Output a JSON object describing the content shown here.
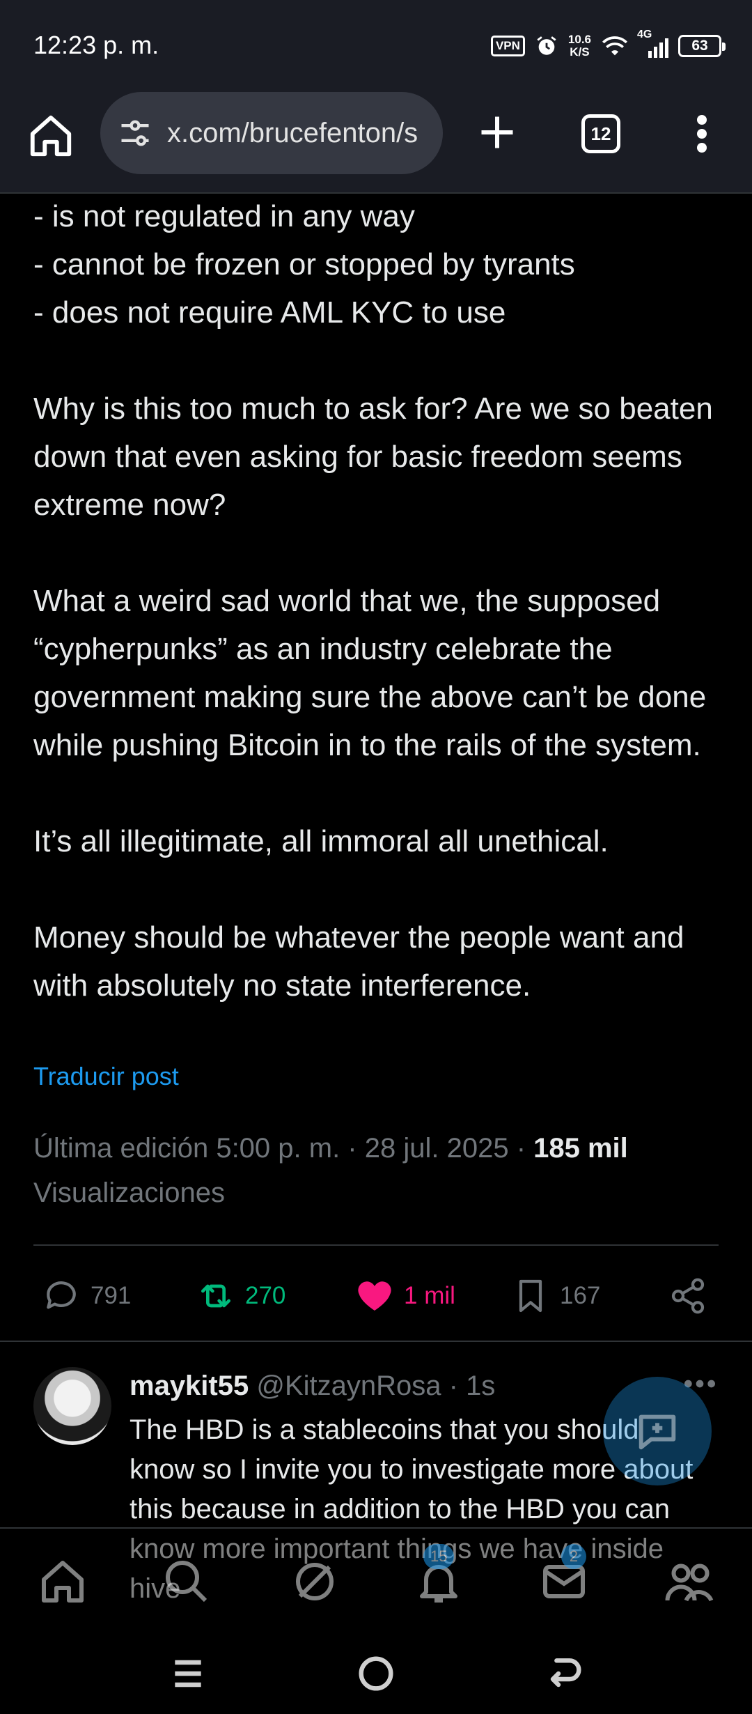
{
  "status": {
    "time": "12:23 p. m.",
    "vpn": "VPN",
    "speed_value": "10.6",
    "speed_unit": "K/S",
    "network": "4G",
    "battery": "63"
  },
  "browser": {
    "url": "x.com/brucefenton/s",
    "tab_count": "12"
  },
  "post": {
    "paragraphs": [
      "- is not regulated in any way\n- cannot be frozen or stopped by tyrants\n- does not require AML KYC to use",
      "Why is this too much to ask for?  Are we so beaten down that even asking for basic freedom seems extreme now?",
      "What a weird sad world that we, the supposed “cypherpunks” as an industry celebrate the government making sure the above can’t be done while pushing Bitcoin in to the rails of the system.",
      "It’s all illegitimate, all immoral all unethical.",
      "Money should be whatever the people want and with absolutely no state interference."
    ],
    "translate_link": "Traducir post",
    "meta_edited": "Última edición 5:00 p. m. · 28 jul. 2025 · ",
    "views_count": "185 mil",
    "views_label": "Visualizaciones"
  },
  "actions": {
    "replies": "791",
    "reposts": "270",
    "likes": "1 mil",
    "bookmarks": "167",
    "colors": {
      "repost": "#00ba7c",
      "like": "#f91880",
      "muted": "#71767b"
    }
  },
  "reply": {
    "name": "maykit55",
    "handle": "@KitzaynRosa · 1s",
    "text": "The HBD is a stablecoins that you should know so I invite you to investigate more about this because in addition to the HBD you can know more important things we have inside hive"
  },
  "bottom_nav": {
    "notifications_badge": "15",
    "messages_badge": "2"
  }
}
